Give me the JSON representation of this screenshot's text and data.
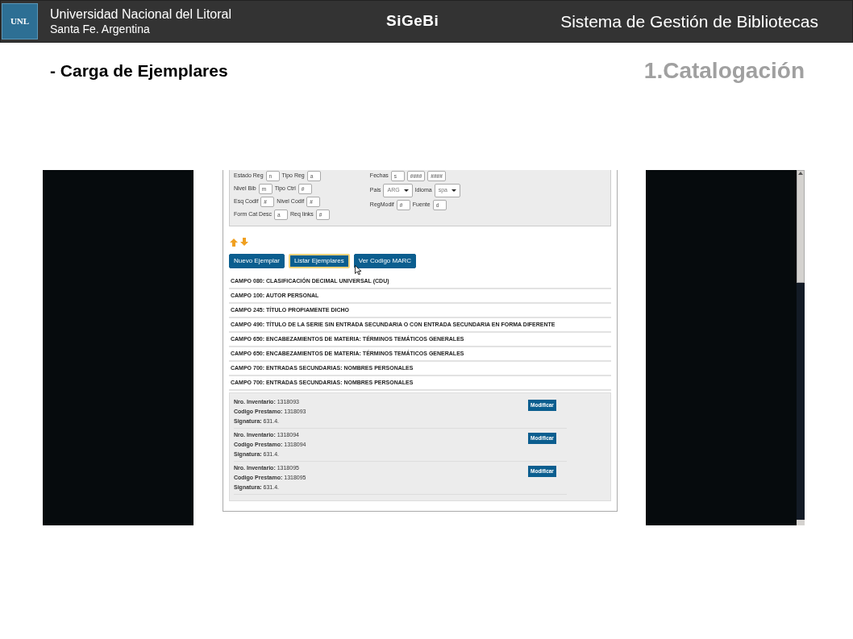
{
  "header": {
    "logo": "UNL",
    "university": "Universidad Nacional del Litoral",
    "location": "Santa Fe. Argentina",
    "app": "SiGeBi",
    "system": "Sistema de Gestión de Bibliotecas"
  },
  "slide": {
    "title": "- Carga de Ejemplares",
    "section": "1.Catalogación"
  },
  "screen": {
    "form": {
      "left": [
        [
          {
            "kind": "label",
            "text": "Estado Reg"
          },
          {
            "kind": "input",
            "value": "n"
          },
          {
            "kind": "label",
            "text": "Tipo Reg"
          },
          {
            "kind": "input",
            "value": "a"
          }
        ],
        [
          {
            "kind": "label",
            "text": "Nivel Bib"
          },
          {
            "kind": "input",
            "value": "m"
          },
          {
            "kind": "label",
            "text": "Tipo Ctrl"
          },
          {
            "kind": "input",
            "value": "#"
          }
        ],
        [
          {
            "kind": "label",
            "text": "Esq Codif"
          },
          {
            "kind": "input",
            "value": "#"
          },
          {
            "kind": "label",
            "text": "Nivel Codif"
          },
          {
            "kind": "input",
            "value": "#"
          }
        ],
        [
          {
            "kind": "label",
            "text": "Form Cat Desc"
          },
          {
            "kind": "input",
            "value": "a"
          },
          {
            "kind": "label",
            "text": "Req links"
          },
          {
            "kind": "input",
            "value": "#"
          }
        ]
      ],
      "right": [
        [
          {
            "kind": "label",
            "text": "Fechas"
          },
          {
            "kind": "input",
            "value": "s"
          },
          {
            "kind": "input",
            "value": "####"
          },
          {
            "kind": "input",
            "value": "####"
          }
        ],
        [
          {
            "kind": "label",
            "text": "Pais"
          },
          {
            "kind": "select",
            "value": "ARG"
          },
          {
            "kind": "label",
            "text": "Idioma"
          },
          {
            "kind": "select",
            "value": "spa"
          }
        ],
        [
          {
            "kind": "label",
            "text": "RegModif"
          },
          {
            "kind": "input",
            "value": "#"
          },
          {
            "kind": "label",
            "text": "Fuente"
          },
          {
            "kind": "input",
            "value": "d"
          }
        ]
      ]
    },
    "buttons": [
      {
        "label": "Nuevo Ejemplar",
        "selected": false
      },
      {
        "label": "Listar Ejemplares",
        "selected": true
      },
      {
        "label": "Ver Codigo MARC",
        "selected": false
      }
    ],
    "fields": [
      "CAMPO 080: CLASIFICACIÓN DECIMAL UNIVERSAL (CDU)",
      "CAMPO 100: AUTOR PERSONAL",
      "CAMPO 245: TÍTULO PROPIAMENTE DICHO",
      "CAMPO 490: TÍTULO DE LA SERIE SIN ENTRADA SECUNDARIA O CON ENTRADA SECUNDARIA EN FORMA DIFERENTE",
      "CAMPO 650: ENCABEZAMIENTOS DE MATERIA: TÉRMINOS TEMÁTICOS GENERALES",
      "CAMPO 650: ENCABEZAMIENTOS DE MATERIA: TÉRMINOS TEMÁTICOS GENERALES",
      "CAMPO 700: ENTRADAS SECUNDARIAS: NOMBRES PERSONALES",
      "CAMPO 700: ENTRADAS SECUNDARIAS: NOMBRES PERSONALES"
    ],
    "copies": [
      {
        "lines": [
          "**Nro. Inventario:** 1318093",
          "**Codigo Prestamo:** 1318093",
          "**Signatura:** 631.4."
        ],
        "button": "Modificar"
      },
      {
        "lines": [
          "**Nro. Inventario:** 1318094",
          "**Codigo Prestamo:** 1318094",
          "**Signatura:** 631.4."
        ],
        "button": "Modificar"
      },
      {
        "lines": [
          "**Nro. Inventario:** 1318095",
          "**Codigo Prestamo:** 1318095",
          "**Signatura:** 631.4."
        ],
        "button": "Modificar"
      }
    ]
  }
}
